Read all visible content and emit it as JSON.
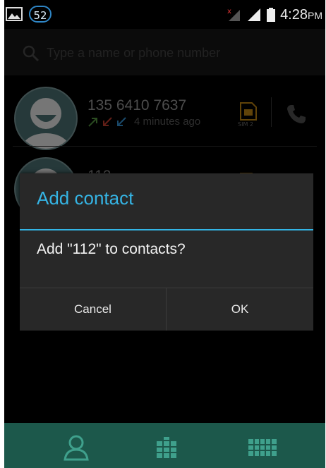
{
  "status_bar": {
    "notification_count": "52",
    "time": "4:28",
    "time_suffix": "PM",
    "icons": [
      "gallery-icon",
      "signal-sim1-no-service-icon",
      "signal-sim2-icon",
      "battery-icon"
    ]
  },
  "search": {
    "placeholder": "Type a name or phone number",
    "value": ""
  },
  "call_log": [
    {
      "number": "135 6410 7637",
      "time": "4 minutes ago",
      "sim_label": "SIM 2",
      "call_types": [
        "outgoing",
        "missed",
        "incoming"
      ],
      "call_type_colors": [
        "#4f8b3d",
        "#b23a2a",
        "#2e86c1"
      ]
    },
    {
      "number": "112"
    }
  ],
  "dialog": {
    "title": "Add contact",
    "message": "Add \"112\" to contacts?",
    "cancel_label": "Cancel",
    "ok_label": "OK",
    "accent_color": "#33b5e5"
  },
  "bottom_nav": {
    "items": [
      "contacts-icon",
      "call-log-icon",
      "dialpad-icon"
    ],
    "background": "#1c584b"
  }
}
